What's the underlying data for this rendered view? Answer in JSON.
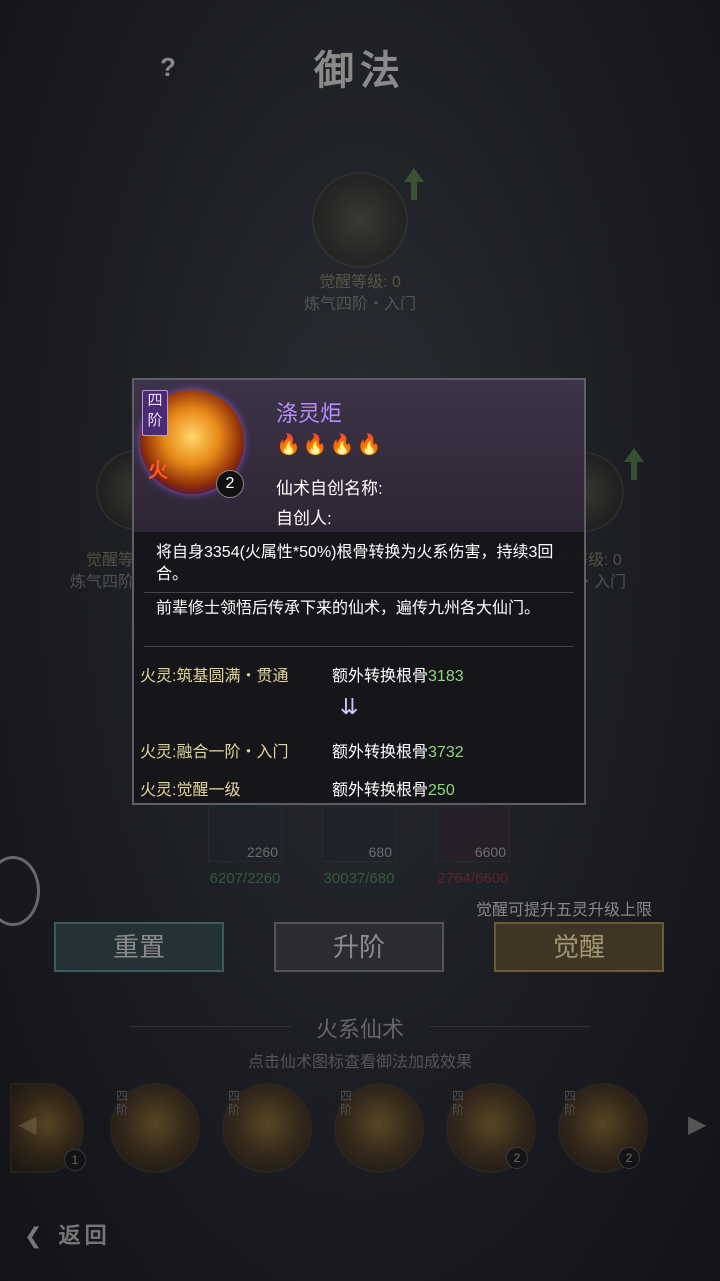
{
  "header": {
    "title": "御法",
    "help": "?"
  },
  "nodes": {
    "top": {
      "level_label": "觉醒等级:",
      "level_value": "0",
      "rank": "炼气四阶・入门"
    },
    "left": {
      "level_label": "觉醒等",
      "rank": "炼气四阶"
    },
    "right": {
      "level_label": "醒等级:",
      "level_value": "0",
      "rank": "炼气四阶・入门"
    }
  },
  "popup": {
    "tier": "四阶",
    "element": "火",
    "count": "2",
    "name": "涤灵炬",
    "flames_active": 2,
    "flames_total": 4,
    "custom_name_label": "仙术自创名称:",
    "creator_label": "自创人:",
    "effect": "将自身3354(火属性*50%)根骨转换为火系伤害，持续3回合。",
    "lore": "前辈修士领悟后传承下来的仙术，遍传九州各大仙门。",
    "rows": [
      {
        "left": "火灵:筑基圆满・贯通",
        "right": "额外转换根骨",
        "value": "3183"
      },
      {
        "left": "火灵:融合一阶・入门",
        "right": "额外转换根骨",
        "value": "3732"
      },
      {
        "left": "火灵:觉醒一级",
        "right": "额外转换根骨",
        "value": "250"
      }
    ]
  },
  "resources": [
    {
      "count": "2260",
      "total": "6207/2260",
      "color": "#3e8a4a"
    },
    {
      "count": "680",
      "total": "30037/680",
      "color": "#3e8a4a"
    },
    {
      "count": "6600",
      "total": "2764/6600",
      "color": "#8a2a2a"
    }
  ],
  "hint": "觉醒可提升五灵升级上限",
  "buttons": {
    "reset": "重置",
    "upgrade": "升阶",
    "awaken": "觉醒"
  },
  "section": {
    "title": "火系仙术",
    "subtitle": "点击仙术图标查看御法加成效果"
  },
  "skill_slots": [
    {
      "tier": "",
      "count": "1"
    },
    {
      "tier": "四阶",
      "count": ""
    },
    {
      "tier": "四阶",
      "count": ""
    },
    {
      "tier": "四阶",
      "count": ""
    },
    {
      "tier": "四阶",
      "count": "2"
    },
    {
      "tier": "四阶",
      "count": "2"
    }
  ],
  "back_label": "返回",
  "icons": {
    "back": "back-arrow-icon",
    "left_nav": "left-arrow-icon",
    "right_nav": "right-arrow-icon",
    "chevron": "double-chevron-down-icon"
  }
}
